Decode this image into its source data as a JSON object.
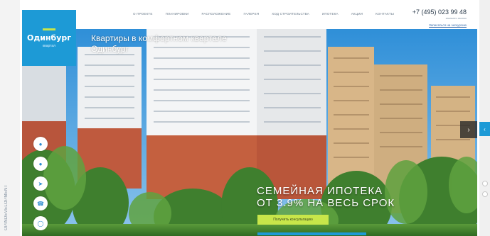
{
  "rail": {
    "text": "OPINDEVELOPMENT"
  },
  "logo": {
    "name": "Одинбург",
    "subtitle": "квартал"
  },
  "nav": {
    "items": [
      "О ПРОЕКТЕ",
      "ПЛАНИРОВКИ",
      "РАСПОЛОЖЕНИЕ",
      "ГАЛЕРЕЯ",
      "ХОД СТРОИТЕЛЬСТВА",
      "ИПОТЕКА",
      "АКЦИИ",
      "КОНТАКТЫ"
    ]
  },
  "contact": {
    "phone": "+7 (495) 023 99 48",
    "callback_label": "заказать звонок",
    "link_label": "Записаться на экскурсию"
  },
  "hero": {
    "title": "Квартиры в комфортном квартале Одинбург"
  },
  "promo": {
    "line1": "СЕМЕЙНАЯ ИПОТЕКА",
    "line2": "ОТ 3.9% НА ВЕСЬ СРОК",
    "button_label": "Получить консультацию"
  },
  "social": [
    "vk",
    "ok",
    "telegram",
    "viber",
    "instagram"
  ],
  "colors": {
    "brand": "#1d9ad6",
    "accent": "#c8e64a",
    "sky": "#2f8fd8"
  }
}
